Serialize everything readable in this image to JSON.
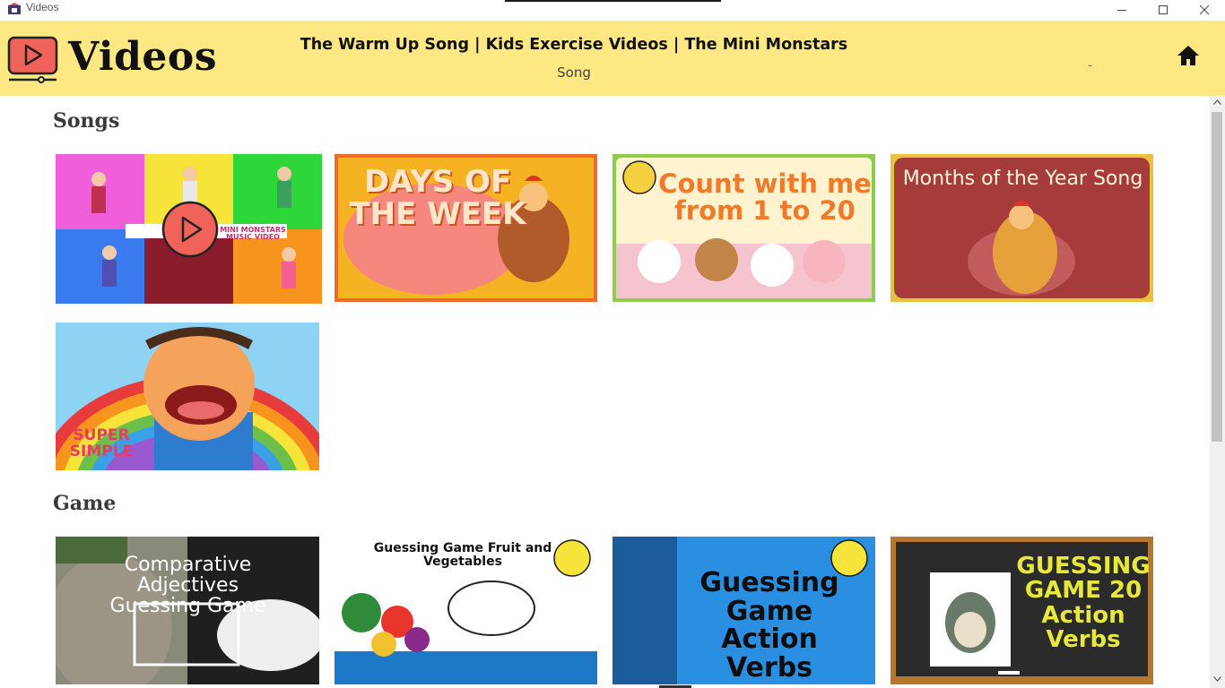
{
  "window": {
    "title": "Videos"
  },
  "header": {
    "app_name": "Videos",
    "now_playing_title": "The Warm Up Song | Kids Exercise Videos | The Mini Monstars",
    "now_playing_category": "Song",
    "dots": "..",
    "colors": {
      "header_bg": "#fde883",
      "logo_red": "#f0635a"
    }
  },
  "sections": [
    {
      "title": "Songs",
      "videos": [
        {
          "caption": "MINI MONSTARS MUSIC VIDEO",
          "playing": true
        },
        {
          "caption": "DAYS OF THE WEEK"
        },
        {
          "caption": "Count with me from 1 to 20"
        },
        {
          "caption": "Months of the Year Song"
        },
        {
          "caption": "SUPER SIMPLE"
        }
      ]
    },
    {
      "title": "Game",
      "videos": [
        {
          "caption": "Comparative Adjectives Guessing Game"
        },
        {
          "caption": "Guessing Game Fruit and Vegetables"
        },
        {
          "caption": "Guessing Game Action Verbs"
        },
        {
          "caption": "GUESSING GAME 20 Action Verbs"
        }
      ]
    }
  ],
  "icons": [
    "video-logo-icon",
    "home-icon",
    "play-icon",
    "minimize-icon",
    "maximize-icon",
    "close-icon"
  ]
}
